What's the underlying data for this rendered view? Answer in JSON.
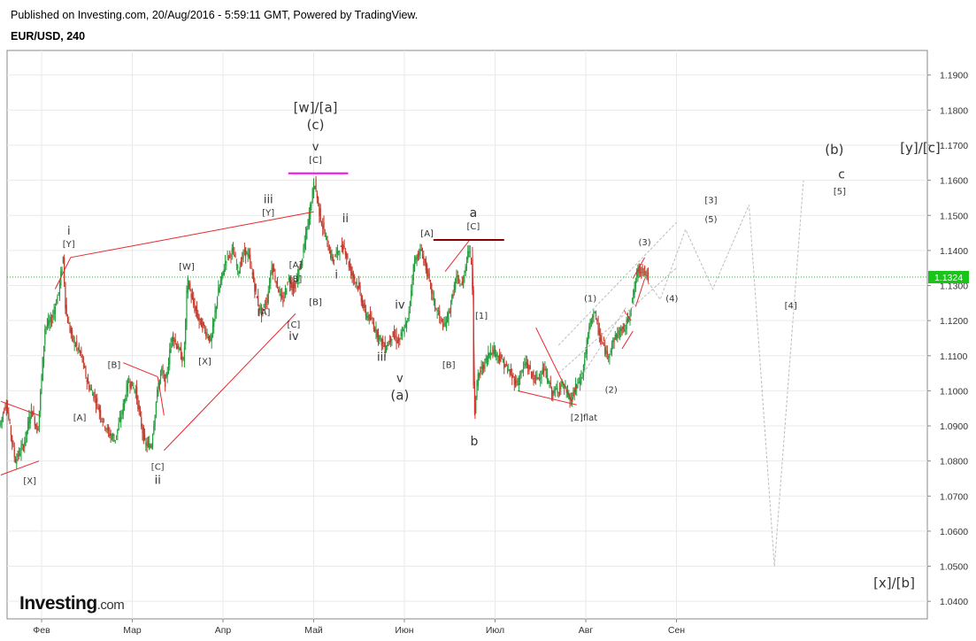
{
  "header": {
    "published": "Published on Investing.com, 20/Aug/2016 - 5:59:11 GMT, Powered by TradingView.",
    "symbol": "EUR/USD, 240"
  },
  "logo": {
    "main": "Investing",
    "domain": ".com"
  },
  "colors": {
    "up": "#1f9e3a",
    "down": "#c0392b",
    "trend": "#e8262b",
    "forecast": "#bdbdbd",
    "price_tag": "#19c519",
    "grid": "#e9e9e9",
    "magenta": "#ff00ff",
    "darkred": "#8b0000"
  },
  "chart_data": {
    "type": "candlestick",
    "symbol": "EUR/USD",
    "timeframe": "240",
    "ylim": [
      1.035,
      1.197
    ],
    "y_ticks": [
      "1.0400",
      "1.0500",
      "1.0600",
      "1.0700",
      "1.0800",
      "1.0900",
      "1.1000",
      "1.1100",
      "1.1200",
      "1.1300",
      "1.1400",
      "1.1500",
      "1.1600",
      "1.1700",
      "1.1800",
      "1.1900"
    ],
    "x_ticks": [
      {
        "label": "Фев",
        "t": 1.0
      },
      {
        "label": "Мар",
        "t": 2.0
      },
      {
        "label": "Апр",
        "t": 3.0
      },
      {
        "label": "Май",
        "t": 4.0
      },
      {
        "label": "Июн",
        "t": 5.0
      },
      {
        "label": "Июл",
        "t": 6.0
      },
      {
        "label": "Авг",
        "t": 7.0
      },
      {
        "label": "Сен",
        "t": 8.0
      }
    ],
    "xlim": [
      0.55,
      10.55
    ],
    "last_price": "1.1324",
    "price_path": [
      [
        0.55,
        1.09
      ],
      [
        0.62,
        1.097
      ],
      [
        0.72,
        1.08
      ],
      [
        0.82,
        1.085
      ],
      [
        0.9,
        1.095
      ],
      [
        0.97,
        1.088
      ],
      [
        1.05,
        1.118
      ],
      [
        1.12,
        1.12
      ],
      [
        1.2,
        1.128
      ],
      [
        1.25,
        1.138
      ],
      [
        1.28,
        1.122
      ],
      [
        1.35,
        1.115
      ],
      [
        1.45,
        1.11
      ],
      [
        1.52,
        1.102
      ],
      [
        1.6,
        1.098
      ],
      [
        1.68,
        1.092
      ],
      [
        1.75,
        1.088
      ],
      [
        1.82,
        1.086
      ],
      [
        1.9,
        1.094
      ],
      [
        1.97,
        1.103
      ],
      [
        2.05,
        1.1
      ],
      [
        2.1,
        1.092
      ],
      [
        2.15,
        1.085
      ],
      [
        2.22,
        1.084
      ],
      [
        2.28,
        1.098
      ],
      [
        2.33,
        1.106
      ],
      [
        2.38,
        1.102
      ],
      [
        2.45,
        1.116
      ],
      [
        2.52,
        1.112
      ],
      [
        2.58,
        1.108
      ],
      [
        2.62,
        1.132
      ],
      [
        2.68,
        1.125
      ],
      [
        2.75,
        1.12
      ],
      [
        2.82,
        1.117
      ],
      [
        2.88,
        1.114
      ],
      [
        2.95,
        1.127
      ],
      [
        3.05,
        1.138
      ],
      [
        3.12,
        1.14
      ],
      [
        3.18,
        1.134
      ],
      [
        3.25,
        1.14
      ],
      [
        3.3,
        1.138
      ],
      [
        3.38,
        1.127
      ],
      [
        3.43,
        1.122
      ],
      [
        3.5,
        1.126
      ],
      [
        3.55,
        1.136
      ],
      [
        3.6,
        1.131
      ],
      [
        3.67,
        1.125
      ],
      [
        3.73,
        1.132
      ],
      [
        3.8,
        1.129
      ],
      [
        3.88,
        1.137
      ],
      [
        3.95,
        1.148
      ],
      [
        4.02,
        1.16
      ],
      [
        4.08,
        1.15
      ],
      [
        4.15,
        1.143
      ],
      [
        4.22,
        1.137
      ],
      [
        4.28,
        1.14
      ],
      [
        4.35,
        1.141
      ],
      [
        4.42,
        1.134
      ],
      [
        4.5,
        1.13
      ],
      [
        4.58,
        1.122
      ],
      [
        4.65,
        1.12
      ],
      [
        4.72,
        1.116
      ],
      [
        4.8,
        1.112
      ],
      [
        4.88,
        1.116
      ],
      [
        4.95,
        1.114
      ],
      [
        5.05,
        1.12
      ],
      [
        5.12,
        1.137
      ],
      [
        5.2,
        1.14
      ],
      [
        5.28,
        1.132
      ],
      [
        5.35,
        1.124
      ],
      [
        5.45,
        1.118
      ],
      [
        5.52,
        1.124
      ],
      [
        5.58,
        1.132
      ],
      [
        5.65,
        1.13
      ],
      [
        5.72,
        1.141
      ],
      [
        5.76,
        1.135
      ],
      [
        5.78,
        1.092
      ],
      [
        5.82,
        1.104
      ],
      [
        5.9,
        1.108
      ],
      [
        5.97,
        1.112
      ],
      [
        6.05,
        1.11
      ],
      [
        6.15,
        1.106
      ],
      [
        6.25,
        1.102
      ],
      [
        6.35,
        1.108
      ],
      [
        6.45,
        1.103
      ],
      [
        6.55,
        1.106
      ],
      [
        6.65,
        1.099
      ],
      [
        6.75,
        1.102
      ],
      [
        6.85,
        1.097
      ],
      [
        6.9,
        1.101
      ],
      [
        6.97,
        1.104
      ],
      [
        7.05,
        1.118
      ],
      [
        7.1,
        1.123
      ],
      [
        7.17,
        1.115
      ],
      [
        7.25,
        1.11
      ],
      [
        7.35,
        1.116
      ],
      [
        7.45,
        1.118
      ],
      [
        7.52,
        1.125
      ],
      [
        7.58,
        1.134
      ],
      [
        7.65,
        1.135
      ],
      [
        7.7,
        1.132
      ]
    ],
    "red_lines": [
      [
        [
          0.55,
          1.097
        ],
        [
          0.97,
          1.093
        ]
      ],
      [
        [
          0.55,
          1.076
        ],
        [
          0.97,
          1.08
        ]
      ],
      [
        [
          1.15,
          1.129
        ],
        [
          1.32,
          1.138
        ]
      ],
      [
        [
          1.32,
          1.138
        ],
        [
          4.0,
          1.151
        ]
      ],
      [
        [
          1.9,
          1.108
        ],
        [
          2.28,
          1.104
        ]
      ],
      [
        [
          2.28,
          1.104
        ],
        [
          2.35,
          1.093
        ]
      ],
      [
        [
          2.35,
          1.083
        ],
        [
          3.8,
          1.122
        ]
      ],
      [
        [
          5.45,
          1.134
        ],
        [
          5.72,
          1.143
        ]
      ],
      [
        [
          5.75,
          1.141
        ],
        [
          5.78,
          1.092
        ]
      ],
      [
        [
          6.25,
          1.1
        ],
        [
          6.9,
          1.096
        ]
      ],
      [
        [
          6.45,
          1.118
        ],
        [
          6.85,
          1.097
        ]
      ],
      [
        [
          6.85,
          1.097
        ],
        [
          6.9,
          1.102
        ]
      ],
      [
        [
          7.42,
          1.123
        ],
        [
          7.5,
          1.12
        ]
      ],
      [
        [
          7.4,
          1.112
        ],
        [
          7.52,
          1.117
        ]
      ],
      [
        [
          7.52,
          1.132
        ],
        [
          7.65,
          1.138
        ]
      ],
      [
        [
          7.55,
          1.124
        ],
        [
          7.65,
          1.132
        ]
      ]
    ],
    "forecast_path": [
      [
        7.66,
        1.132
      ],
      [
        7.82,
        1.126
      ],
      [
        8.1,
        1.146
      ],
      [
        8.4,
        1.129
      ],
      [
        8.8,
        1.153
      ],
      [
        9.08,
        1.05
      ],
      [
        9.4,
        1.16
      ]
    ],
    "forecast_channel": [
      [
        [
          6.7,
          1.113
        ],
        [
          8.0,
          1.148
        ]
      ],
      [
        [
          6.7,
          1.105
        ],
        [
          8.0,
          1.135
        ]
      ],
      [
        [
          6.95,
          1.104
        ],
        [
          7.45,
          1.124
        ]
      ]
    ],
    "hlines": [
      {
        "x0": 3.72,
        "x1": 4.38,
        "y": 1.162,
        "color": "#ff00ff"
      },
      {
        "x0": 5.32,
        "x1": 6.1,
        "y": 1.143,
        "color": "#8b0000"
      }
    ],
    "annotations": [
      {
        "text": "[w]/[a]",
        "x": 4.02,
        "y": 1.1795,
        "size": 15
      },
      {
        "text": "(c)",
        "x": 4.02,
        "y": 1.1745,
        "size": 15
      },
      {
        "text": "v",
        "x": 4.02,
        "y": 1.1685,
        "size": 13
      },
      {
        "text": "[C]",
        "x": 4.02,
        "y": 1.165,
        "size": 10
      },
      {
        "text": "i",
        "x": 1.3,
        "y": 1.1445,
        "size": 13
      },
      {
        "text": "[Y]",
        "x": 1.3,
        "y": 1.141,
        "size": 10
      },
      {
        "text": "iii",
        "x": 3.5,
        "y": 1.1535,
        "size": 13
      },
      {
        "text": "[Y]",
        "x": 3.5,
        "y": 1.15,
        "size": 10
      },
      {
        "text": "ii",
        "x": 4.35,
        "y": 1.148,
        "size": 13
      },
      {
        "text": "i",
        "x": 4.25,
        "y": 1.132,
        "size": 13
      },
      {
        "text": "[A]",
        "x": 3.8,
        "y": 1.135,
        "size": 10
      },
      {
        "text": "[B]",
        "x": 3.8,
        "y": 1.131,
        "size": 10
      },
      {
        "text": "[B]",
        "x": 4.02,
        "y": 1.1245,
        "size": 10
      },
      {
        "text": "[C]",
        "x": 3.78,
        "y": 1.118,
        "size": 10
      },
      {
        "text": "iv",
        "x": 3.78,
        "y": 1.1145,
        "size": 13
      },
      {
        "text": "[A]",
        "x": 3.45,
        "y": 1.1215,
        "size": 10
      },
      {
        "text": "[W]",
        "x": 2.6,
        "y": 1.1345,
        "size": 10
      },
      {
        "text": "[X]",
        "x": 2.8,
        "y": 1.1075,
        "size": 10
      },
      {
        "text": "[B]",
        "x": 1.8,
        "y": 1.1065,
        "size": 10
      },
      {
        "text": "[A]",
        "x": 1.42,
        "y": 1.0915,
        "size": 10
      },
      {
        "text": "[X]",
        "x": 0.87,
        "y": 1.0735,
        "size": 10
      },
      {
        "text": "[C]",
        "x": 2.28,
        "y": 1.0775,
        "size": 10
      },
      {
        "text": "ii",
        "x": 2.28,
        "y": 1.0735,
        "size": 13
      },
      {
        "text": "iii",
        "x": 4.75,
        "y": 1.1085,
        "size": 13
      },
      {
        "text": "iv",
        "x": 4.95,
        "y": 1.1235,
        "size": 13
      },
      {
        "text": "v",
        "x": 4.95,
        "y": 1.1025,
        "size": 13
      },
      {
        "text": "(a)",
        "x": 4.95,
        "y": 1.0975,
        "size": 15
      },
      {
        "text": "[A]",
        "x": 5.25,
        "y": 1.144,
        "size": 10
      },
      {
        "text": "a",
        "x": 5.76,
        "y": 1.1495,
        "size": 14
      },
      {
        "text": "[C]",
        "x": 5.76,
        "y": 1.146,
        "size": 10
      },
      {
        "text": "[1]",
        "x": 5.85,
        "y": 1.1205,
        "size": 10
      },
      {
        "text": "[B]",
        "x": 5.49,
        "y": 1.1065,
        "size": 10
      },
      {
        "text": "b",
        "x": 5.77,
        "y": 1.0845,
        "size": 14
      },
      {
        "text": "[2]flat",
        "x": 6.98,
        "y": 1.0915,
        "size": 10
      },
      {
        "text": "(1)",
        "x": 7.05,
        "y": 1.1255,
        "size": 10
      },
      {
        "text": "(2)",
        "x": 7.28,
        "y": 1.0995,
        "size": 10
      },
      {
        "text": "(3)",
        "x": 7.65,
        "y": 1.1415,
        "size": 10
      },
      {
        "text": "(4)",
        "x": 7.95,
        "y": 1.1255,
        "size": 10
      },
      {
        "text": "(5)",
        "x": 8.38,
        "y": 1.148,
        "size": 10
      },
      {
        "text": "[3]",
        "x": 8.38,
        "y": 1.1535,
        "size": 10
      },
      {
        "text": "[4]",
        "x": 9.26,
        "y": 1.1235,
        "size": 10
      },
      {
        "text": "[5]",
        "x": 9.8,
        "y": 1.156,
        "size": 10
      },
      {
        "text": "c",
        "x": 9.82,
        "y": 1.1605,
        "size": 14
      },
      {
        "text": "(b)",
        "x": 9.74,
        "y": 1.1675,
        "size": 15
      },
      {
        "text": "[y]/[c]",
        "x": 11.05,
        "y": 1.168,
        "size": 15
      },
      {
        "text": "[x]/[b]",
        "x": 10.4,
        "y": 1.044,
        "size": 15
      }
    ]
  }
}
